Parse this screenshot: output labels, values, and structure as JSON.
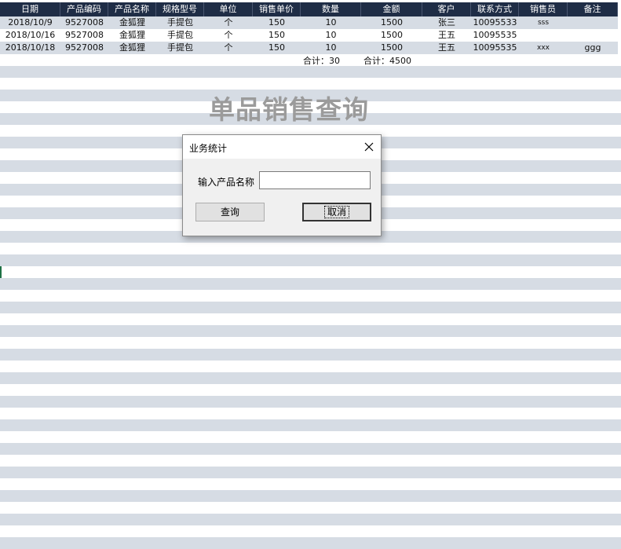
{
  "sheet": {
    "headers": [
      "日期",
      "产品编码",
      "产品名称",
      "规格型号",
      "单位",
      "销售单价",
      "数量",
      "金额",
      "客户",
      "联系方式",
      "销售员",
      "备注"
    ],
    "rows": [
      [
        "2018/10/9",
        "9527008",
        "金狐狸",
        "手提包",
        "个",
        "150",
        "10",
        "1500",
        "张三",
        "10095533",
        "sss",
        ""
      ],
      [
        "2018/10/16",
        "9527008",
        "金狐狸",
        "手提包",
        "个",
        "150",
        "10",
        "1500",
        "王五",
        "10095535",
        "",
        ""
      ],
      [
        "2018/10/18",
        "9527008",
        "金狐狸",
        "手提包",
        "个",
        "150",
        "10",
        "1500",
        "王五",
        "10095535",
        "xxx",
        "ggg"
      ]
    ],
    "total_qty": "合计：30",
    "total_amount": "合计：4500",
    "band_color": "#d6dce4",
    "header_color": "#1f2d46"
  },
  "title": "单品销售查询",
  "dialog": {
    "title": "业务统计",
    "close_icon": "close-icon",
    "field_label": "输入产品名称",
    "input_value": "",
    "query_label": "查询",
    "cancel_label": "取消"
  }
}
